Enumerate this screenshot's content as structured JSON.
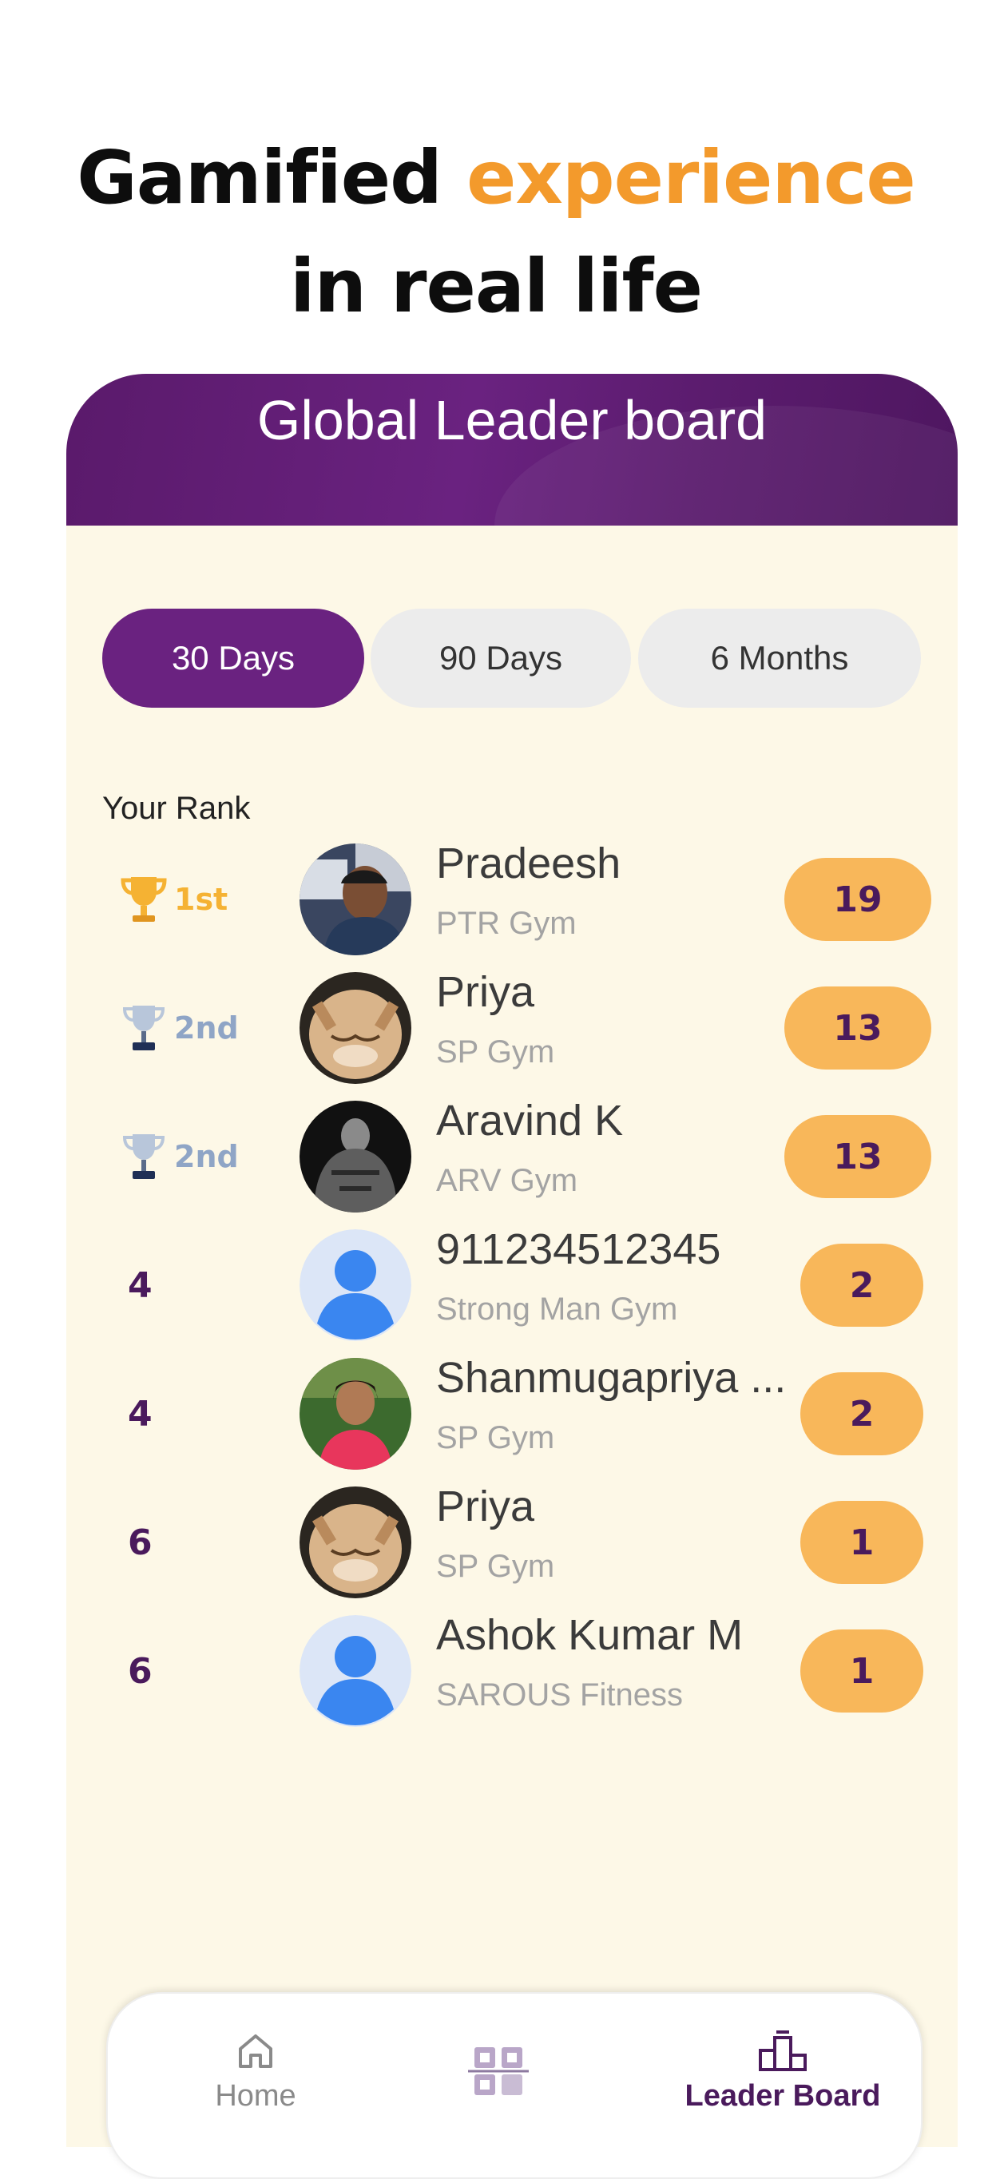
{
  "headline": {
    "part1": "Gamified ",
    "accent": "experience",
    "line2": "in real life"
  },
  "colors": {
    "brand_purple": "#6a2280",
    "accent_orange": "#f39a2c",
    "score_badge": "#f8b75a",
    "background": "#fdf8e7"
  },
  "header": {
    "title": "Global Leader board"
  },
  "tabs": [
    {
      "label": "30 Days",
      "active": true
    },
    {
      "label": "90 Days",
      "active": false
    },
    {
      "label": "6 Months",
      "active": false
    }
  ],
  "your_rank_label": "Your Rank",
  "leaderboard": [
    {
      "rank": "1st",
      "trophy": "gold-trophy-icon",
      "name": "Pradeesh",
      "gym": "PTR Gym",
      "score": "19",
      "avatar": "photo-man"
    },
    {
      "rank": "2nd",
      "trophy": "silver-trophy-icon",
      "name": "Priya",
      "gym": "SP Gym",
      "score": "13",
      "avatar": "photo-cat"
    },
    {
      "rank": "2nd",
      "trophy": "silver-trophy-icon",
      "name": "Aravind K",
      "gym": "ARV Gym",
      "score": "13",
      "avatar": "photo-dark"
    },
    {
      "rank": "4",
      "trophy": "",
      "name": "911234512345",
      "gym": "Strong Man Gym",
      "score": "2",
      "avatar": "default-user-icon"
    },
    {
      "rank": "4",
      "trophy": "",
      "name": "Shanmugapriya ...",
      "gym": "SP Gym",
      "score": "2",
      "avatar": "photo-woman"
    },
    {
      "rank": "6",
      "trophy": "",
      "name": "Priya",
      "gym": "SP Gym",
      "score": "1",
      "avatar": "photo-cat"
    },
    {
      "rank": "6",
      "trophy": "",
      "name": "Ashok Kumar M",
      "gym": "SAROUS Fitness",
      "score": "1",
      "avatar": "default-user-icon"
    }
  ],
  "bottom_nav": {
    "home": "Home",
    "scan_icon": "qr-scan-icon",
    "leaderboard": "Leader Board"
  }
}
